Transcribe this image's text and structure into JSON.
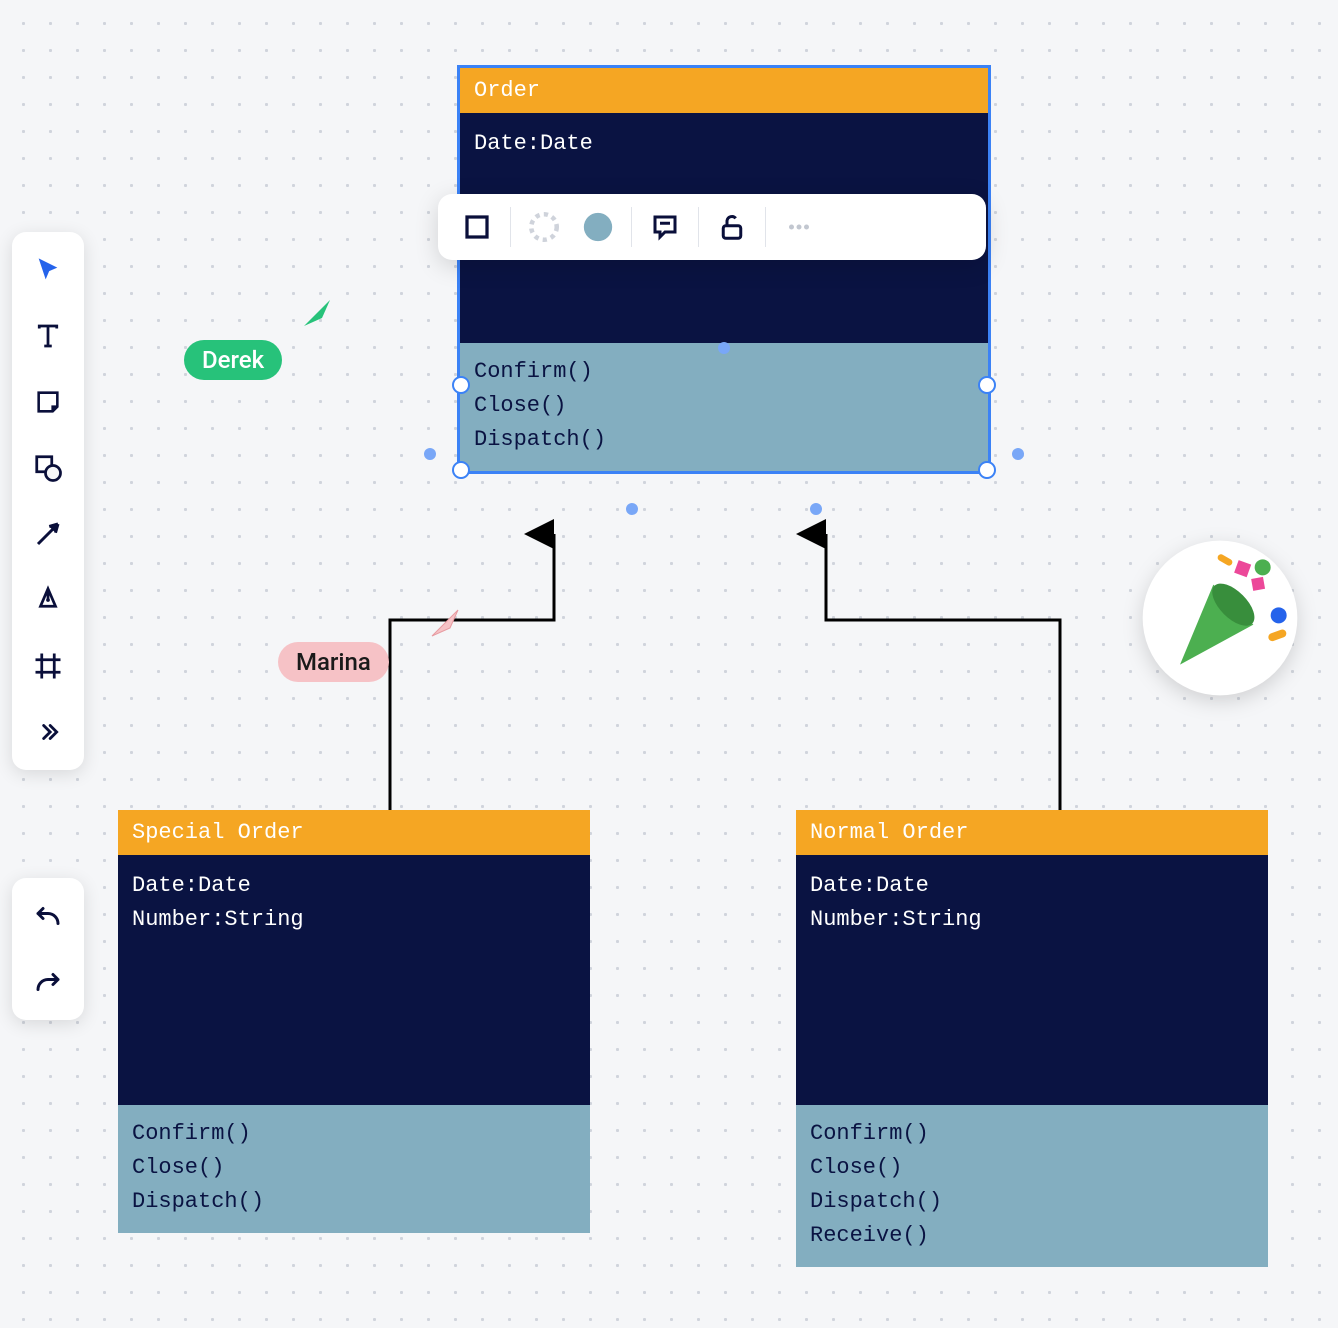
{
  "collaborators": {
    "derek": {
      "name": "Derek",
      "color": "#27c27a",
      "text": "#fff"
    },
    "marina": {
      "name": "Marina",
      "color": "#f6c2c6",
      "text": "#1a1a1a"
    }
  },
  "uml": {
    "order": {
      "title": "Order",
      "attrs": [
        "Date:Date"
      ],
      "ops": [
        "Confirm()",
        "Close()",
        "Dispatch()"
      ]
    },
    "special": {
      "title": "Special Order",
      "attrs": [
        "Date:Date",
        "Number:String"
      ],
      "ops": [
        "Confirm()",
        "Close()",
        "Dispatch()"
      ]
    },
    "normal": {
      "title": "Normal Order",
      "attrs": [
        "Date:Date",
        "Number:String"
      ],
      "ops": [
        "Confirm()",
        "Close()",
        "Dispatch()",
        "Receive()"
      ]
    }
  },
  "toolbar": {
    "tools": [
      "select",
      "text",
      "sticky",
      "shape",
      "arrow",
      "pen",
      "frame",
      "more"
    ],
    "history": [
      "undo",
      "redo"
    ]
  },
  "floating_toolbar": {
    "items": [
      "square",
      "border-style",
      "fill-color",
      "comment",
      "unlock",
      "more"
    ]
  },
  "colors": {
    "header": "#f5a623",
    "body": "#0a1342",
    "ops": "#83aec0",
    "selection": "#3b82f6",
    "fill_swatch": "#83aec0"
  }
}
